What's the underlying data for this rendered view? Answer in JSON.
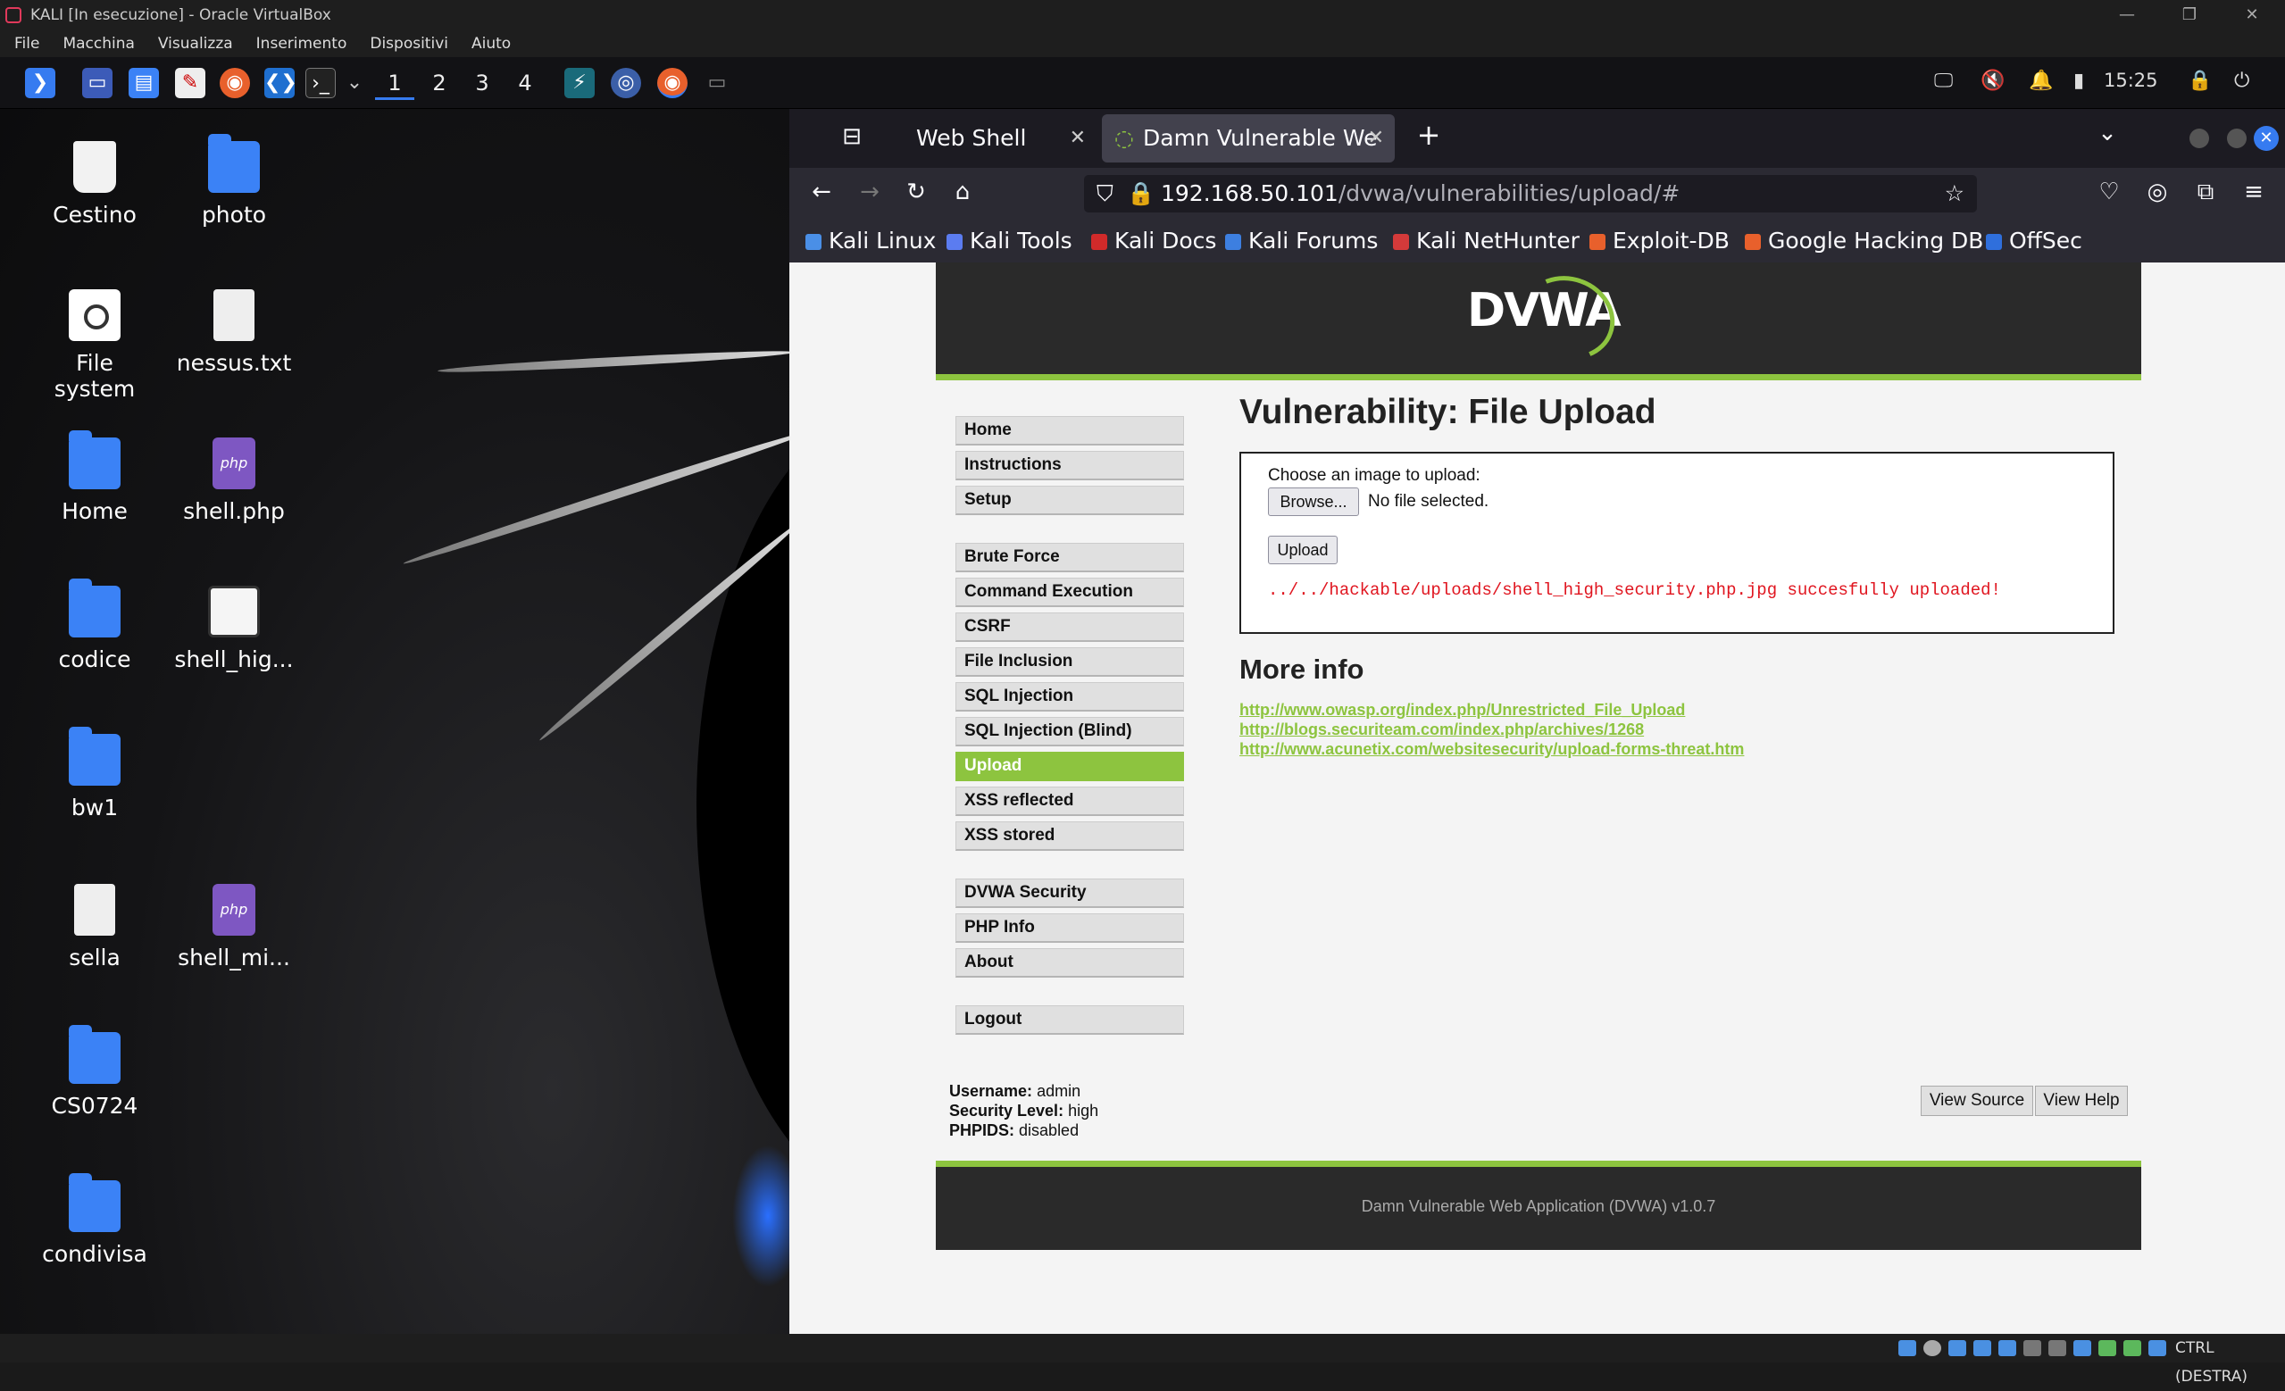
{
  "vbox": {
    "title": "KALI [In esecuzione] - Oracle VirtualBox",
    "menu": [
      "File",
      "Macchina",
      "Visualizza",
      "Inserimento",
      "Dispositivi",
      "Aiuto"
    ],
    "host_key": "CTRL (DESTRA)"
  },
  "panel": {
    "workspaces": [
      "1",
      "2",
      "3",
      "4"
    ],
    "time": "15:25"
  },
  "desktop": {
    "icons": [
      {
        "label": "Cestino",
        "icon": "trash-icon"
      },
      {
        "label": "photo",
        "icon": "folder-icon"
      },
      {
        "label": "File system",
        "icon": "drive-icon"
      },
      {
        "label": "nessus.txt",
        "icon": "text-file-icon"
      },
      {
        "label": "Home",
        "icon": "home-folder-icon"
      },
      {
        "label": "shell.php",
        "icon": "php-file-icon"
      },
      {
        "label": "codice",
        "icon": "folder-icon"
      },
      {
        "label": "shell_hig...",
        "icon": "vscode-file-icon"
      },
      {
        "label": "bw1",
        "icon": "folder-icon"
      },
      {
        "label": "sella",
        "icon": "text-file-icon"
      },
      {
        "label": "shell_mi...",
        "icon": "php-file-icon"
      },
      {
        "label": "CS0724",
        "icon": "folder-icon"
      },
      {
        "label": "condivisa",
        "icon": "folder-icon"
      }
    ]
  },
  "browser": {
    "tabs": [
      {
        "label": "Web Shell"
      },
      {
        "label": "Damn Vulnerable We"
      }
    ],
    "url_host": "192.168.50.101",
    "url_path": "/dvwa/vulnerabilities/upload/#",
    "bookmarks": [
      {
        "label": "Kali Linux",
        "color": "#4a8fe7"
      },
      {
        "label": "Kali Tools",
        "color": "#5b7cf0"
      },
      {
        "label": "Kali Docs",
        "color": "#d12a2a"
      },
      {
        "label": "Kali Forums",
        "color": "#3d7fe0"
      },
      {
        "label": "Kali NetHunter",
        "color": "#d43a3a"
      },
      {
        "label": "Exploit-DB",
        "color": "#e8602c"
      },
      {
        "label": "Google Hacking DB",
        "color": "#e8602c"
      },
      {
        "label": "OffSec",
        "color": "#2f6fdc"
      }
    ]
  },
  "dvwa": {
    "logo": "DVWA",
    "menu_group1": [
      "Home",
      "Instructions",
      "Setup"
    ],
    "menu_group2": [
      "Brute Force",
      "Command Execution",
      "CSRF",
      "File Inclusion",
      "SQL Injection",
      "SQL Injection (Blind)",
      "Upload",
      "XSS reflected",
      "XSS stored"
    ],
    "menu_group3": [
      "DVWA Security",
      "PHP Info",
      "About"
    ],
    "menu_group4": [
      "Logout"
    ],
    "selected": "Upload",
    "heading": "Vulnerability: File Upload",
    "choose_label": "Choose an image to upload:",
    "browse_button": "Browse...",
    "no_file": "No file selected.",
    "upload_button": "Upload",
    "message": "../../hackable/uploads/shell_high_security.php.jpg succesfully uploaded!",
    "more_info": "More info",
    "links": [
      "http://www.owasp.org/index.php/Unrestricted_File_Upload",
      "http://blogs.securiteam.com/index.php/archives/1268",
      "http://www.acunetix.com/websitesecurity/upload-forms-threat.htm"
    ],
    "username_label": "Username:",
    "username": "admin",
    "security_label": "Security Level:",
    "security": "high",
    "phpids_label": "PHPIDS:",
    "phpids": "disabled",
    "view_source": "View Source",
    "view_help": "View Help",
    "footer": "Damn Vulnerable Web Application (DVWA) v1.0.7"
  }
}
